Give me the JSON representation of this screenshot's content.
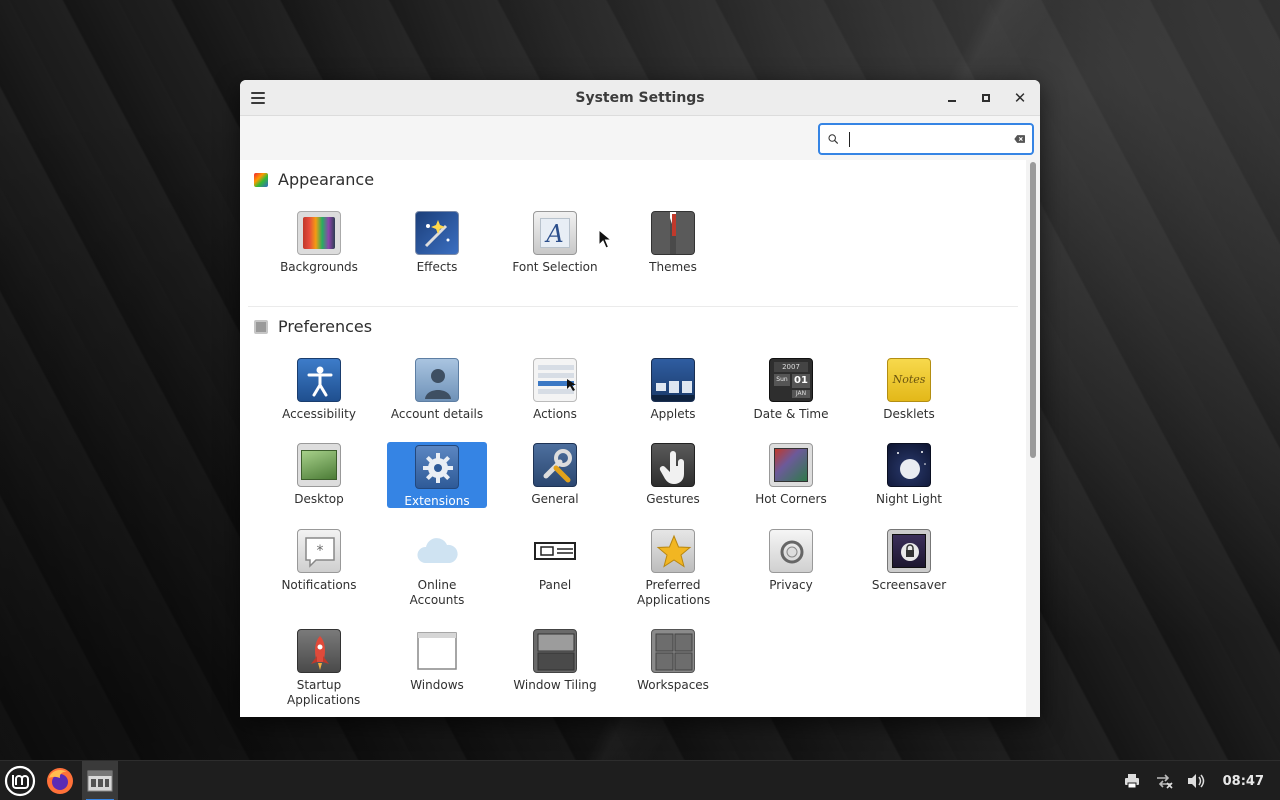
{
  "window": {
    "title": "System Settings",
    "search": {
      "value": "",
      "placeholder": ""
    }
  },
  "sections": {
    "appearance": {
      "title": "Appearance",
      "items": [
        {
          "label": "Backgrounds"
        },
        {
          "label": "Effects"
        },
        {
          "label": "Font Selection"
        },
        {
          "label": "Themes"
        }
      ]
    },
    "preferences": {
      "title": "Preferences",
      "items": [
        {
          "label": "Accessibility"
        },
        {
          "label": "Account details"
        },
        {
          "label": "Actions"
        },
        {
          "label": "Applets"
        },
        {
          "label": "Date & Time"
        },
        {
          "label": "Desklets"
        },
        {
          "label": "Desktop"
        },
        {
          "label": "Extensions",
          "selected": true
        },
        {
          "label": "General"
        },
        {
          "label": "Gestures"
        },
        {
          "label": "Hot Corners"
        },
        {
          "label": "Night Light"
        },
        {
          "label": "Notifications"
        },
        {
          "label": "Online Accounts"
        },
        {
          "label": "Panel"
        },
        {
          "label": "Preferred Applications"
        },
        {
          "label": "Privacy"
        },
        {
          "label": "Screensaver"
        },
        {
          "label": "Startup Applications"
        },
        {
          "label": "Windows"
        },
        {
          "label": "Window Tiling"
        },
        {
          "label": "Workspaces"
        }
      ]
    }
  },
  "date_time_icon": {
    "year": "2007",
    "day": "01",
    "month": "JAN",
    "weekday": "Sun"
  },
  "desklets_icon": {
    "text": "Notes"
  },
  "taskbar": {
    "clock": "08:47"
  },
  "colors": {
    "accent": "#3584e4",
    "taskbar_bg": "#1e1e1e"
  }
}
